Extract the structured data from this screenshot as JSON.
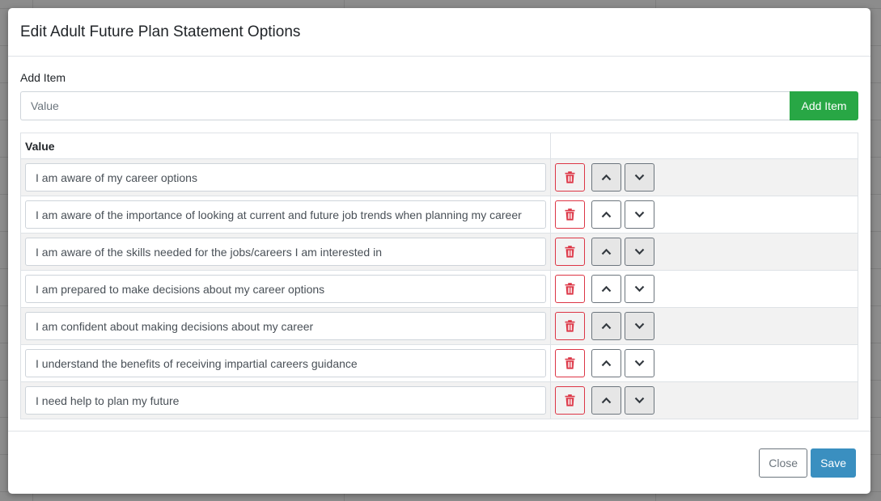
{
  "modal": {
    "title": "Edit Adult Future Plan Statement Options"
  },
  "add_item": {
    "label": "Add Item",
    "placeholder": "Value",
    "value": "",
    "button_label": "Add Item"
  },
  "table": {
    "headers": [
      "Value",
      ""
    ],
    "rows": [
      {
        "value": "I am aware of my career options"
      },
      {
        "value": "I am aware of the importance of looking at current and future job trends when planning my career"
      },
      {
        "value": "I am aware of the skills needed for the jobs/careers I am interested in"
      },
      {
        "value": "I am prepared to make decisions about my career options"
      },
      {
        "value": "I am confident about making decisions about my career"
      },
      {
        "value": "I understand the benefits of receiving impartial careers guidance"
      },
      {
        "value": "I need help to plan my future"
      }
    ],
    "row_icons": {
      "delete": "trash-icon",
      "move_up": "chevron-up-icon",
      "move_down": "chevron-down-icon"
    }
  },
  "footer": {
    "close_label": "Close",
    "save_label": "Save"
  },
  "colors": {
    "add_button": "#28a745",
    "save_button": "#3a8fc0",
    "delete_accent": "#dc3545"
  }
}
